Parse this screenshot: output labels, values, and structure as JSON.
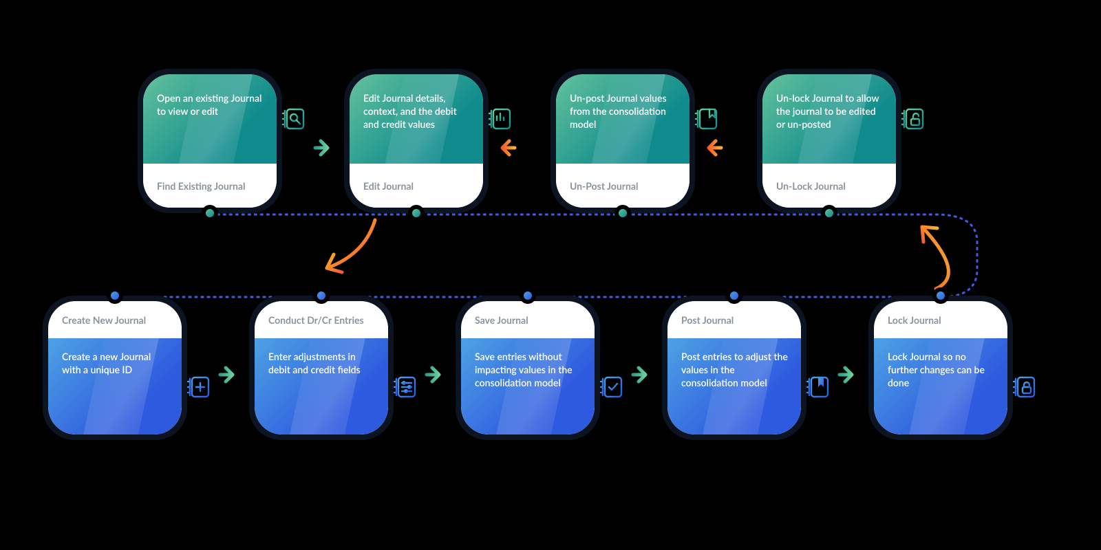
{
  "colors": {
    "teal_gradient": [
      "#63c29b",
      "#0f8b8d"
    ],
    "blue_gradient": [
      "#4ea2e4",
      "#2e5adf"
    ],
    "green_arrow_gradient": [
      "#2f9d8a",
      "#6bcf9c"
    ],
    "orange_arrow_gradient": [
      "#f75a2d",
      "#f7b52d"
    ],
    "card_border": "#0c1422",
    "label_text": "#8a93a0",
    "background": "#000000",
    "dotted_path": "#3f5ad6"
  },
  "top_row": [
    {
      "title": "Find Existing Journal",
      "desc": "Open an existing Journal to view or edit",
      "icon": "search-doc-icon"
    },
    {
      "title": "Edit Journal",
      "desc": "Edit Journal details, context, and the debit and credit values",
      "icon": "chart-doc-icon"
    },
    {
      "title": "Un-Post Journal",
      "desc": "Un-post Journal values from the consolidation model",
      "icon": "bookmark-doc-icon"
    },
    {
      "title": "Un-Lock Journal",
      "desc": "Un-lock Journal to allow the journal to be edited or un-posted",
      "icon": "unlock-doc-icon"
    }
  ],
  "bottom_row": [
    {
      "title": "Create New Journal",
      "desc": "Create a new Journal with a unique ID",
      "icon": "plus-doc-icon"
    },
    {
      "title": "Conduct Dr/Cr Entries",
      "desc": "Enter adjustments in debit and credit fields",
      "icon": "sliders-doc-icon"
    },
    {
      "title": "Save Journal",
      "desc": "Save entries without impacting values in the consolidation model",
      "icon": "check-doc-icon"
    },
    {
      "title": "Post Journal",
      "desc": "Post entries to adjust the values in the consolidation model",
      "icon": "bookmark-fill-doc-icon"
    },
    {
      "title": "Lock Journal",
      "desc": "Lock Journal so no further changes can be done",
      "icon": "lock-doc-icon"
    }
  ],
  "top_row_arrows": [
    {
      "from": 0,
      "to": 1,
      "direction": "right",
      "color": "green"
    },
    {
      "from": 2,
      "to": 1,
      "direction": "left",
      "color": "orange"
    },
    {
      "from": 3,
      "to": 2,
      "direction": "left",
      "color": "orange"
    }
  ],
  "bottom_row_arrows": [
    {
      "from": 0,
      "to": 1,
      "direction": "right",
      "color": "green"
    },
    {
      "from": 1,
      "to": 2,
      "direction": "right",
      "color": "green"
    },
    {
      "from": 2,
      "to": 3,
      "direction": "right",
      "color": "green"
    },
    {
      "from": 3,
      "to": 4,
      "direction": "right",
      "color": "green"
    }
  ],
  "cross_arrows": [
    {
      "from": "top_row.1",
      "to": "bottom_row.0_or_1",
      "direction": "down-left",
      "color": "orange"
    },
    {
      "from": "bottom_row.4",
      "to": "top_row.3",
      "direction": "up-left",
      "color": "orange"
    }
  ],
  "dotted_path": {
    "description": "Blue dotted process path linking all bottom-row dots left-to-right then curving up to connect the top-row dots right-to-left",
    "color": "#3f5ad6"
  }
}
